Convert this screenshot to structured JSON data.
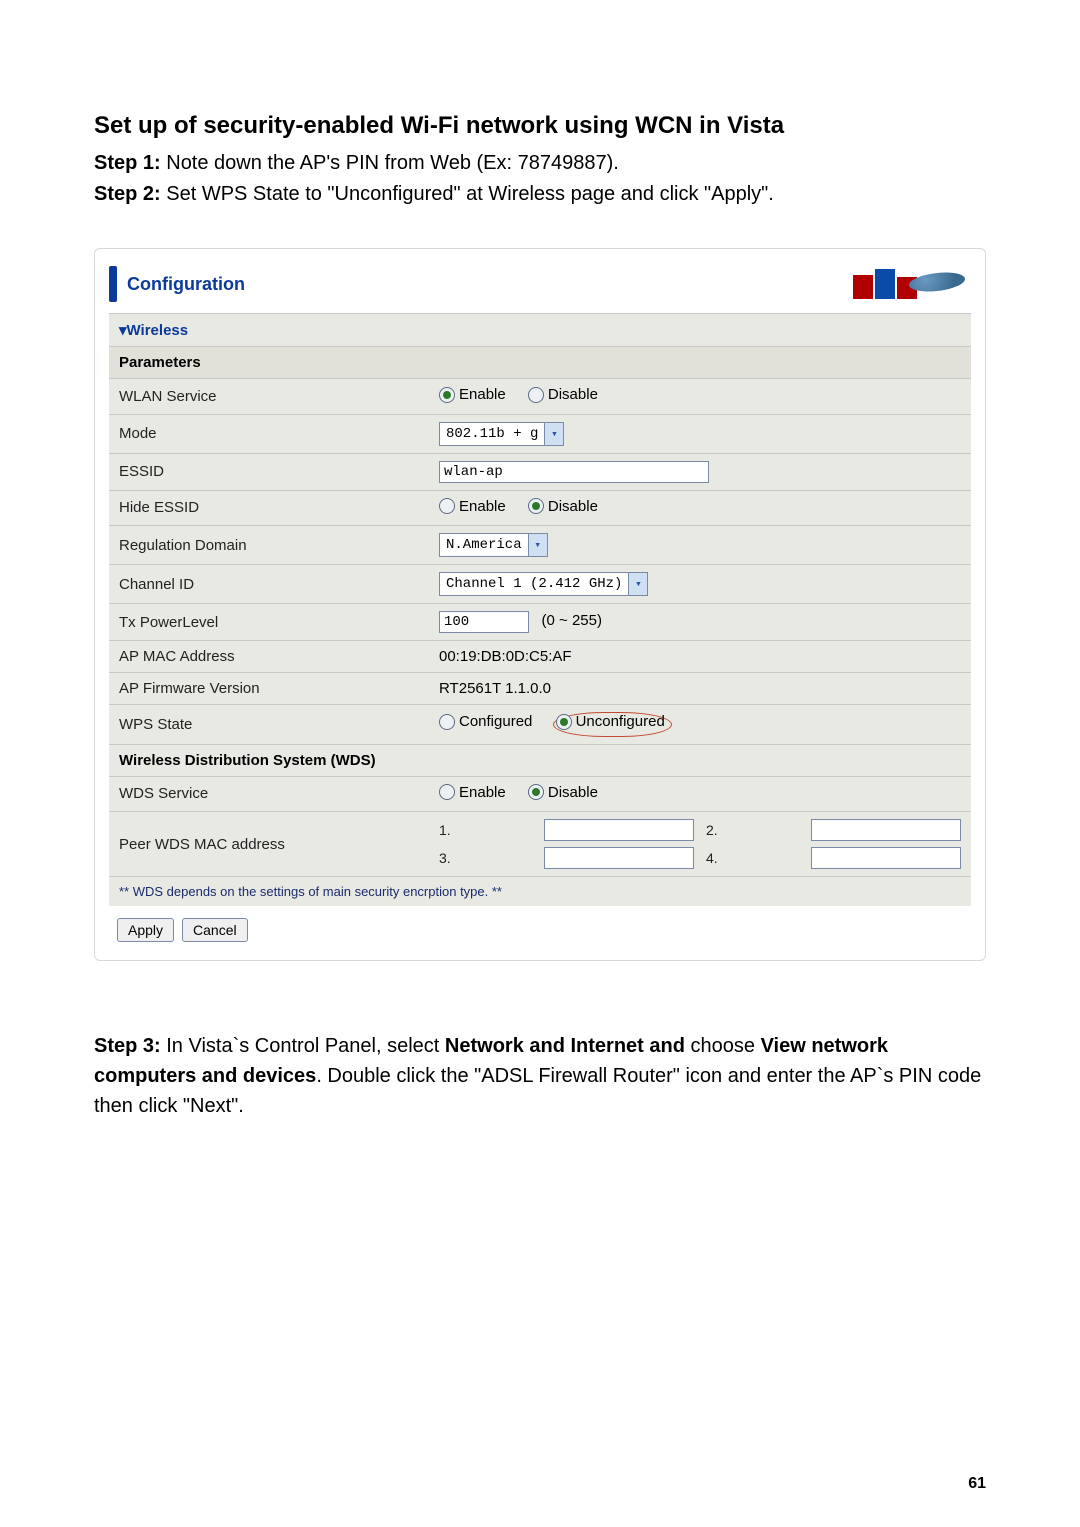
{
  "title": "Set up of security-enabled Wi-Fi network using WCN in Vista",
  "step1_label": "Step 1:",
  "step1_text": " Note down the AP's PIN from Web (Ex: 78749887).",
  "step2_label": "Step 2:",
  "step2_text": " Set WPS State to \"Unconfigured\" at Wireless page and click \"Apply\".",
  "card": {
    "header": "Configuration",
    "section": "▾Wireless",
    "params": "Parameters",
    "wlan_label": "WLAN Service",
    "enable": "Enable",
    "disable": "Disable",
    "mode_label": "Mode",
    "mode_value": "802.11b + g",
    "essid_label": "ESSID",
    "essid_value": "wlan-ap",
    "hide_label": "Hide ESSID",
    "reg_label": "Regulation Domain",
    "reg_value": "N.America",
    "ch_label": "Channel ID",
    "ch_value": "Channel 1 (2.412 GHz)",
    "tx_label": "Tx PowerLevel",
    "tx_value": "100",
    "tx_range": "(0 ~ 255)",
    "mac_label": "AP MAC Address",
    "mac_value": "00:19:DB:0D:C5:AF",
    "fw_label": "AP Firmware Version",
    "fw_value": "RT2561T 1.1.0.0",
    "wps_label": "WPS State",
    "wps_cfg": "Configured",
    "wps_uncfg": "Unconfigured",
    "wds_header": "Wireless Distribution System (WDS)",
    "wds_svc_label": "WDS Service",
    "peer_label": "Peer WDS MAC address",
    "p1": "1.",
    "p2": "2.",
    "p3": "3.",
    "p4": "4.",
    "wds_note": "** WDS depends on the settings of main security encrption type. **",
    "apply": "Apply",
    "cancel": "Cancel"
  },
  "step3_label": "Step 3:",
  "step3_a": " In Vista`s Control Panel, select ",
  "step3_b": "Network and Internet and ",
  "step3_c": "choose ",
  "step3_d": "View network computers and devices",
  "step3_e": ". Double click the \"ADSL Firewall Router\" icon and enter the AP`s PIN code then click \"Next\".",
  "pageno": "61"
}
